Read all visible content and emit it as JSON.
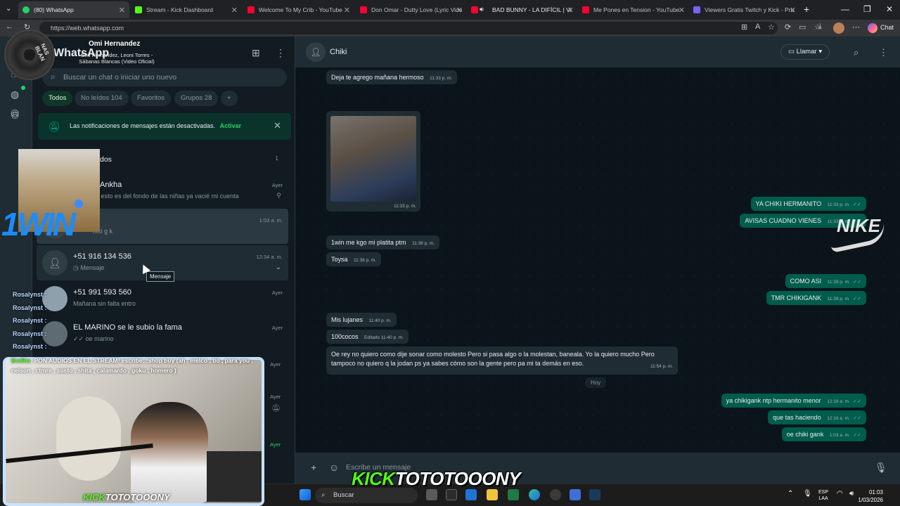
{
  "browser": {
    "tabs": [
      {
        "title": "(80) WhatsApp",
        "active": true,
        "favicon_color": "#25d366",
        "close": "✕"
      },
      {
        "title": "Stream - Kick Dashboard",
        "favicon_color": "#53fc18",
        "close": "✕"
      },
      {
        "title": "Welcome To My Crib - YouTube",
        "favicon_color": "#ff0033",
        "close": "✕"
      },
      {
        "title": "Don Omar - Dutty Love (Lyric Vide",
        "favicon_color": "#ff0033",
        "close": "✕"
      },
      {
        "title": "BAD BUNNY - LA DIFÍCIL | Vi",
        "favicon_color": "#ff0033",
        "close": "✕"
      },
      {
        "title": "Me Pones en Tension - YouTube",
        "favicon_color": "#ff0033",
        "close": "✕"
      },
      {
        "title": "Viewers Gratis Twitch y Kick - Pru",
        "favicon_color": "#7b61ff",
        "close": "✕"
      }
    ],
    "new_tab": "+",
    "url": "https://web.whatsapp.com",
    "copilot_label": "Chat",
    "window_controls": [
      "—",
      "❐",
      "✕"
    ]
  },
  "whatsapp": {
    "sidebar_title": "WhatsApp",
    "search_placeholder": "Buscar un chat o iniciar uno nuevo",
    "filters": [
      {
        "label": "Todos",
        "active": true
      },
      {
        "label": "No leídos 104"
      },
      {
        "label": "Favoritos"
      },
      {
        "label": "Grupos 28"
      },
      {
        "label": "+"
      }
    ],
    "notification": {
      "text": "Las notificaciones de mensajes están desactivadas.",
      "link": "Activar"
    },
    "archived_count": "1",
    "archived_label": "dos",
    "chats": [
      {
        "name": "Ankha",
        "preview": "caso esto es del fondo de las niñas ya vacié mi cuenta",
        "time": "Ayer"
      },
      {
        "name": "",
        "preview": "hiki g   k",
        "time": "1:03 a. m."
      },
      {
        "name": "+51 916 134 536",
        "preview": "Mensaje",
        "time": "12:34 a. m."
      },
      {
        "name": "+51 991 593 560",
        "preview": "Mañana sin falta entro",
        "time": "Ayer"
      },
      {
        "name": "EL MARINO se le subio la fama",
        "preview": "oe marino",
        "time": "Ayer"
      }
    ],
    "extra_times": [
      "Ayer",
      "Ayer",
      "Ayer"
    ],
    "tooltip": "Mensaje",
    "chat": {
      "name": "Chiki",
      "call_label": "Llamar",
      "messages": [
        {
          "dir": "in",
          "text": "Deja te agrego mañana hermoso",
          "time": "11:33 p. m."
        },
        {
          "dir": "in",
          "text": "",
          "time": "11:33 p. m.",
          "photo": true
        },
        {
          "dir": "out",
          "text": "YA CHIKI HERMANITO",
          "time": "11:33 p. m."
        },
        {
          "dir": "out",
          "text": "AVISAS CUADNO VIENES",
          "time": "11:33 p. m."
        },
        {
          "dir": "in",
          "text": "1win me kgo mi platita ptm",
          "time": "11:38 p. m."
        },
        {
          "dir": "in",
          "text": "Toysa",
          "time": "11:38 p. m."
        },
        {
          "dir": "out",
          "text": "COMO ASI",
          "time": "11:39 p. m."
        },
        {
          "dir": "out",
          "text": "TMR CHIKIGANK",
          "time": "11:39 p. m."
        },
        {
          "dir": "in",
          "text": "Mis lujanes",
          "time": "11:40 p. m."
        },
        {
          "dir": "in",
          "text": "100cocos",
          "time": "Editado 11:40 p. m."
        },
        {
          "dir": "in",
          "text": "Oe rey no quiero como dije sonar como molesto Pero si pasa algo o la molestan, baneala. Yo la quiero mucho Pero tampoco no quiero q la jodan ps ya sabes cómo son la gente pero pa mi ta demás en eso.",
          "time": "11:54 p. m."
        },
        {
          "dir": "out",
          "text": "ya chikigank ntp hermanito menor",
          "time": "12:18 a. m."
        },
        {
          "dir": "out",
          "text": "que tas haciendo",
          "time": "12:18 a. m."
        },
        {
          "dir": "out",
          "text": "oe chiki gank",
          "time": "1:03 a. m."
        }
      ],
      "date_divider": "Hoy",
      "composer_placeholder": "Escribe un mensaje"
    },
    "colors": {
      "accent": "#00a884",
      "outgoing": "#005c4b",
      "incoming": "#202c33",
      "read_ticks": "#53bdeb"
    }
  },
  "overlay": {
    "song_title": "Omi Hernandez",
    "song_subtitle": "Omi Hernández, Leoni Torres - Sábanas Blancas (Video Oficial)",
    "vinyl_text": "NAS BLAN",
    "win_logo": "1WIN",
    "nike_logo": "NIKE",
    "chat_users": [
      "Rosalynst :",
      "Rosalynst :",
      "Rosalynst :",
      "Rosalynst :",
      "Rosalynst :"
    ],
    "bot_name": "BotRix",
    "bot_message": ": PON AUDIOS EN EL STREAM! escribe: !shop buy (ah , melco , tío , para you , nelson , ctmre , susto , shita , calamardo , goku , homero )",
    "brand_kick": "KICK",
    "brand_name": "TOTOTOOONY"
  },
  "taskbar": {
    "search_label": "Buscar",
    "lang": "ESP",
    "lang2": "LAA",
    "time": "01:03",
    "date": "1/03/2026"
  }
}
